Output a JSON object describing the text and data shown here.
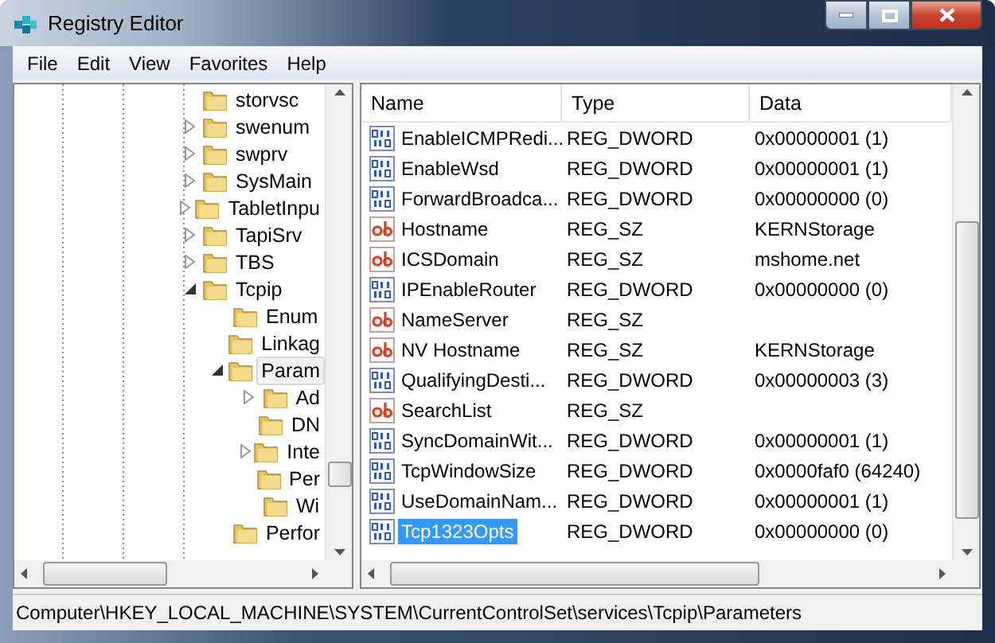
{
  "window": {
    "title": "Registry Editor"
  },
  "menu": [
    "File",
    "Edit",
    "View",
    "Favorites",
    "Help"
  ],
  "tree": [
    {
      "label": "storvsc",
      "kind": "leaf",
      "selected": false
    },
    {
      "label": "swenum",
      "kind": "collapsed",
      "selected": false
    },
    {
      "label": "swprv",
      "kind": "collapsed",
      "selected": false
    },
    {
      "label": "SysMain",
      "kind": "collapsed",
      "selected": false
    },
    {
      "label": "TabletInpu",
      "kind": "collapsed",
      "selected": false
    },
    {
      "label": "TapiSrv",
      "kind": "collapsed",
      "selected": false
    },
    {
      "label": "TBS",
      "kind": "collapsed",
      "selected": false
    },
    {
      "label": "Tcpip",
      "kind": "expanded",
      "selected": false,
      "children": [
        {
          "label": "Enum",
          "kind": "leaf",
          "selected": false
        },
        {
          "label": "Linkag",
          "kind": "leaf",
          "selected": false
        },
        {
          "label": "Param",
          "kind": "expanded",
          "selected": true,
          "children": [
            {
              "label": "Ad",
              "kind": "collapsed",
              "selected": false
            },
            {
              "label": "DN",
              "kind": "leaf",
              "selected": false
            },
            {
              "label": "Inte",
              "kind": "collapsed",
              "selected": false
            },
            {
              "label": "Per",
              "kind": "leaf",
              "selected": false
            },
            {
              "label": "Wi",
              "kind": "leaf",
              "selected": false
            }
          ]
        },
        {
          "label": "Perfor",
          "kind": "leaf",
          "selected": false
        }
      ]
    }
  ],
  "table": {
    "columns": [
      "Name",
      "Type",
      "Data"
    ],
    "rows": [
      {
        "kind": "dword",
        "name": "EnableICMPRedi...",
        "type": "REG_DWORD",
        "data": "0x00000001 (1)",
        "selected": false
      },
      {
        "kind": "dword",
        "name": "EnableWsd",
        "type": "REG_DWORD",
        "data": "0x00000001 (1)",
        "selected": false
      },
      {
        "kind": "dword",
        "name": "ForwardBroadca...",
        "type": "REG_DWORD",
        "data": "0x00000000 (0)",
        "selected": false
      },
      {
        "kind": "sz",
        "name": "Hostname",
        "type": "REG_SZ",
        "data": "KERNStorage",
        "selected": false
      },
      {
        "kind": "sz",
        "name": "ICSDomain",
        "type": "REG_SZ",
        "data": "mshome.net",
        "selected": false
      },
      {
        "kind": "dword",
        "name": "IPEnableRouter",
        "type": "REG_DWORD",
        "data": "0x00000000 (0)",
        "selected": false
      },
      {
        "kind": "sz",
        "name": "NameServer",
        "type": "REG_SZ",
        "selected": false
      },
      {
        "kind": "sz",
        "name": "NV Hostname",
        "type": "REG_SZ",
        "data": "KERNStorage",
        "selected": false
      },
      {
        "kind": "dword",
        "name": "QualifyingDesti...",
        "type": "REG_DWORD",
        "data": "0x00000003 (3)",
        "selected": false
      },
      {
        "kind": "sz",
        "name": "SearchList",
        "type": "REG_SZ",
        "selected": false
      },
      {
        "kind": "dword",
        "name": "SyncDomainWit...",
        "type": "REG_DWORD",
        "data": "0x00000001 (1)",
        "selected": false
      },
      {
        "kind": "dword",
        "name": "TcpWindowSize",
        "type": "REG_DWORD",
        "data": "0x0000faf0 (64240)",
        "selected": false
      },
      {
        "kind": "dword",
        "name": "UseDomainNam...",
        "type": "REG_DWORD",
        "data": "0x00000001 (1)",
        "selected": false
      },
      {
        "kind": "dword",
        "name": "Tcp1323Opts",
        "type": "REG_DWORD",
        "data": "0x00000000 (0)",
        "selected": true
      }
    ]
  },
  "status_bar": "Computer\\HKEY_LOCAL_MACHINE\\SYSTEM\\CurrentControlSet\\services\\Tcpip\\Parameters"
}
